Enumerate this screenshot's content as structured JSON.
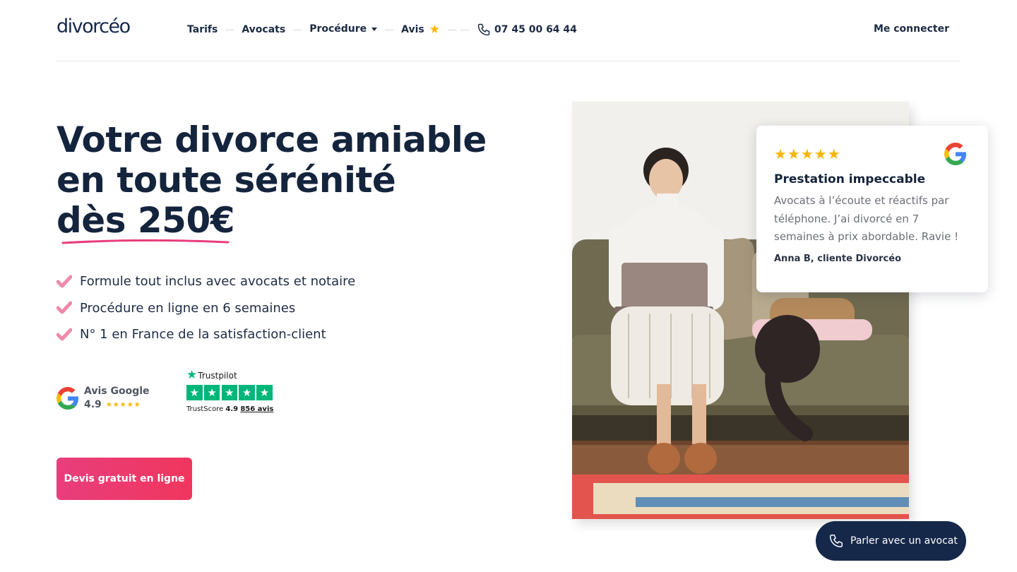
{
  "brand": {
    "logo_text": "divorcéo"
  },
  "nav": {
    "items": [
      {
        "label": "Tarifs"
      },
      {
        "label": "Avocats"
      },
      {
        "label": "Procédure"
      },
      {
        "label": "Avis"
      }
    ],
    "phone": "07 45 00 64 44",
    "login_label": "Me connecter"
  },
  "hero": {
    "headline_line1": "Votre divorce amiable",
    "headline_line2": "en toute sérénité",
    "headline_line3": "dès 250€",
    "features": [
      "Formule tout inclus avec avocats et notaire",
      "Procédure en ligne en 6 semaines",
      "N° 1 en France de la satisfaction-client"
    ],
    "cta_label": "Devis gratuit en ligne"
  },
  "ratings": {
    "google": {
      "title": "Avis Google",
      "score": "4.9",
      "stars": "★★★★★"
    },
    "trustpilot": {
      "brand": "Trustpilot",
      "score_label": "TrustScore",
      "score": "4.9",
      "count": "856 avis"
    }
  },
  "review": {
    "stars": "★★★★★",
    "title": "Prestation impeccable",
    "body": "Avocats à l’écoute et réactifs par téléphone. J’ai divorcé en 7 semaines à prix abordable. Ravie !",
    "author": "Anna B, cliente Divorcéo"
  },
  "call_button": {
    "label": "Parler avec un avocat"
  },
  "colors": {
    "navy": "#16284a",
    "accent_pink": "#e83e7c",
    "star_gold": "#f7b500",
    "trustpilot_green": "#00b67a"
  }
}
